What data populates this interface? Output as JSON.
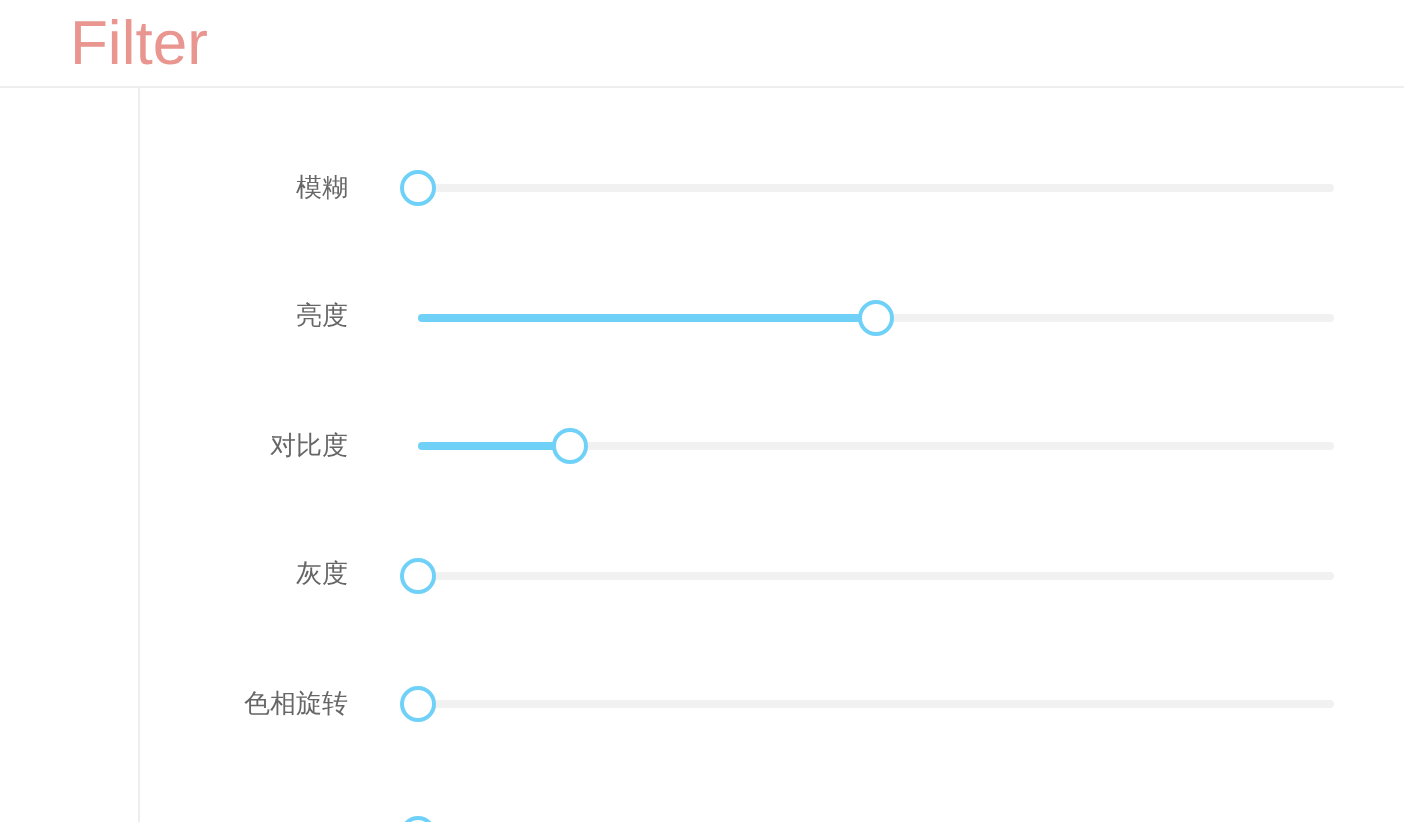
{
  "title": "Filter",
  "sliders": [
    {
      "label": "模糊",
      "level": 0
    },
    {
      "label": "亮度",
      "level": 0.5
    },
    {
      "label": "对比度",
      "level": 0.166
    },
    {
      "label": "灰度",
      "level": 0
    },
    {
      "label": "色相旋转",
      "level": 0
    },
    {
      "level": 0
    }
  ]
}
